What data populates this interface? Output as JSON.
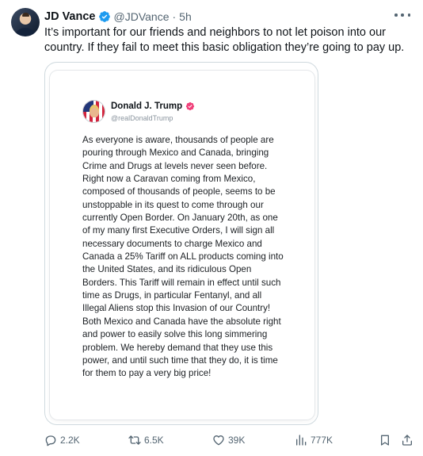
{
  "post": {
    "author_name": "JD Vance",
    "author_handle": "@JDVance",
    "separator": "·",
    "timestamp": "5h",
    "text": "It’s important for our friends and neighbors to not let poison into our country. If they fail to meet this basic obligation they’re going to pay up.",
    "verified_color": "#1d9bf0"
  },
  "embedded": {
    "author_name": "Donald J. Trump",
    "author_handle": "@realDonaldTrump",
    "badge_color": "#f0417a",
    "body": "As everyone is aware, thousands of people are pouring through Mexico and Canada, bringing Crime and Drugs at levels never seen before. Right now a Caravan coming from Mexico, composed of thousands of people, seems to be unstoppable in its quest to come through our currently Open Border. On January 20th, as one of my many first Executive Orders, I will sign all necessary documents to charge Mexico and Canada a 25% Tariff on ALL products coming into the United States, and its ridiculous Open Borders. This Tariff will remain in effect until such time as Drugs, in particular Fentanyl, and all Illegal Aliens stop this Invasion of our Country! Both Mexico and Canada have the absolute right and power to easily solve this long simmering problem. We hereby demand that they use this power, and until such time that they do, it is time for them to pay a very big price!"
  },
  "actions": {
    "replies": "2.2K",
    "reposts": "6.5K",
    "likes": "39K",
    "views": "777K"
  },
  "icons": {
    "more": "more-icon",
    "reply": "reply-icon",
    "repost": "repost-icon",
    "like": "like-icon",
    "views": "views-icon",
    "bookmark": "bookmark-icon",
    "share": "share-icon"
  }
}
